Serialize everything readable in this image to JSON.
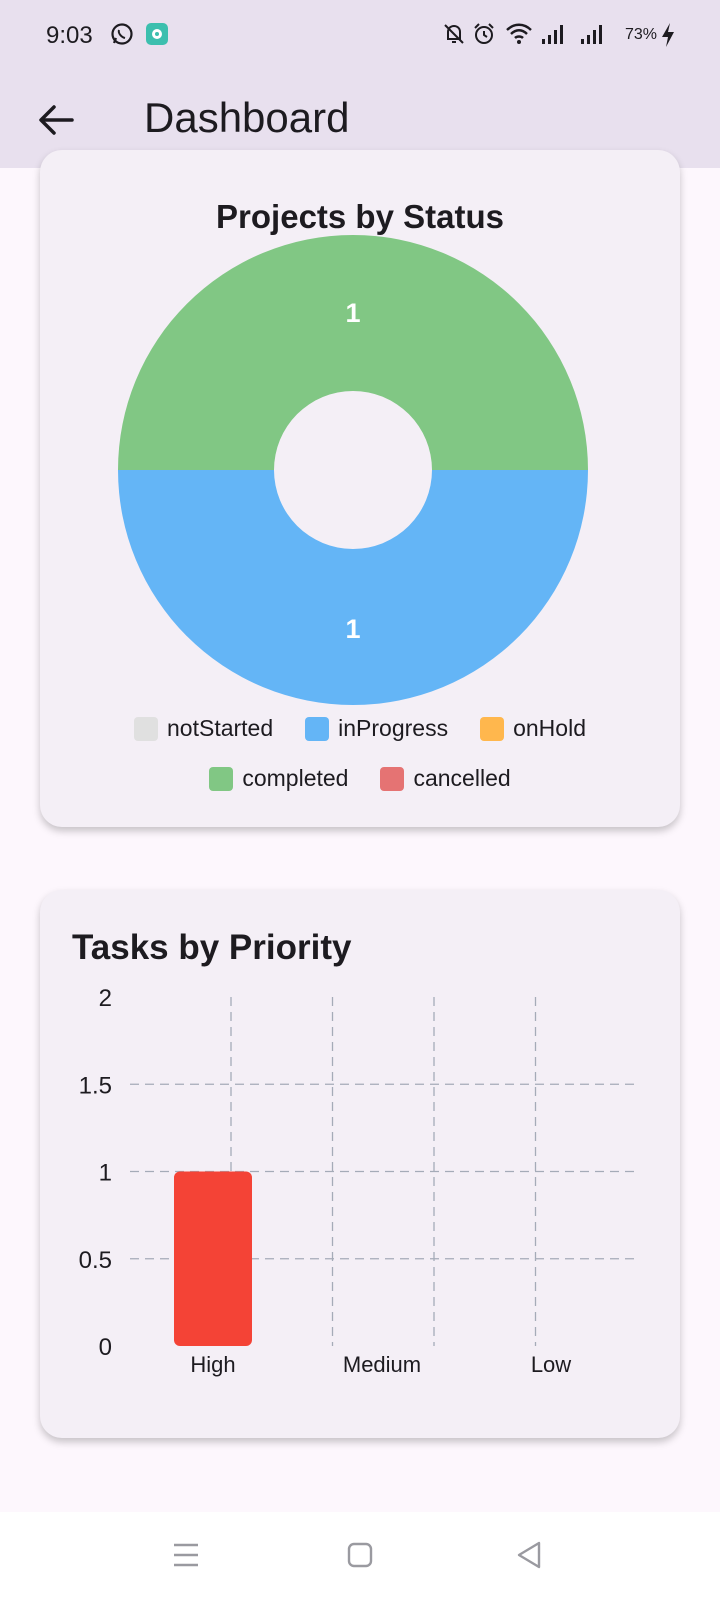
{
  "status_bar": {
    "time": "9:03",
    "battery": "73%",
    "icons": [
      "whatsapp-icon",
      "app-notification-icon",
      "bell-off-icon",
      "alarm-icon",
      "wifi-icon",
      "signal-icon",
      "signal-icon",
      "charging-icon"
    ]
  },
  "app_bar": {
    "title": "Dashboard",
    "back_icon": "arrow-left-icon"
  },
  "projects_card": {
    "title": "Projects by Status"
  },
  "priority_card": {
    "title": "Tasks by Priority"
  },
  "nav_bar": {
    "icons": [
      "menu-icon",
      "home-square-icon",
      "back-triangle-icon"
    ]
  },
  "chart_data": [
    {
      "type": "pie",
      "title": "Projects by Status",
      "donut": true,
      "categories": [
        "notStarted",
        "inProgress",
        "onHold",
        "completed",
        "cancelled"
      ],
      "values": [
        0,
        1,
        0,
        1,
        0
      ],
      "colors": [
        "#e0e0e0",
        "#64b5f6",
        "#ffb74d",
        "#81c784",
        "#e57373"
      ],
      "slice_labels": [
        "1",
        "1"
      ],
      "legend": [
        {
          "name": "notStarted",
          "color": "#e0e0e0"
        },
        {
          "name": "inProgress",
          "color": "#64b5f6"
        },
        {
          "name": "onHold",
          "color": "#ffb74d"
        },
        {
          "name": "completed",
          "color": "#81c784"
        },
        {
          "name": "cancelled",
          "color": "#e57373"
        }
      ],
      "legend_placement": "bottom"
    },
    {
      "type": "bar",
      "title": "Tasks by Priority",
      "categories": [
        "High",
        "Medium",
        "Low"
      ],
      "values": [
        1,
        0,
        0
      ],
      "bar_color": "#f44336",
      "ylim": [
        0,
        2
      ],
      "yticks": [
        "0",
        "0.5",
        "1",
        "1.5",
        "2"
      ],
      "ytick_values": [
        0,
        0.5,
        1,
        1.5,
        2
      ],
      "grid": "dashed",
      "xlabel": "",
      "ylabel": ""
    }
  ]
}
